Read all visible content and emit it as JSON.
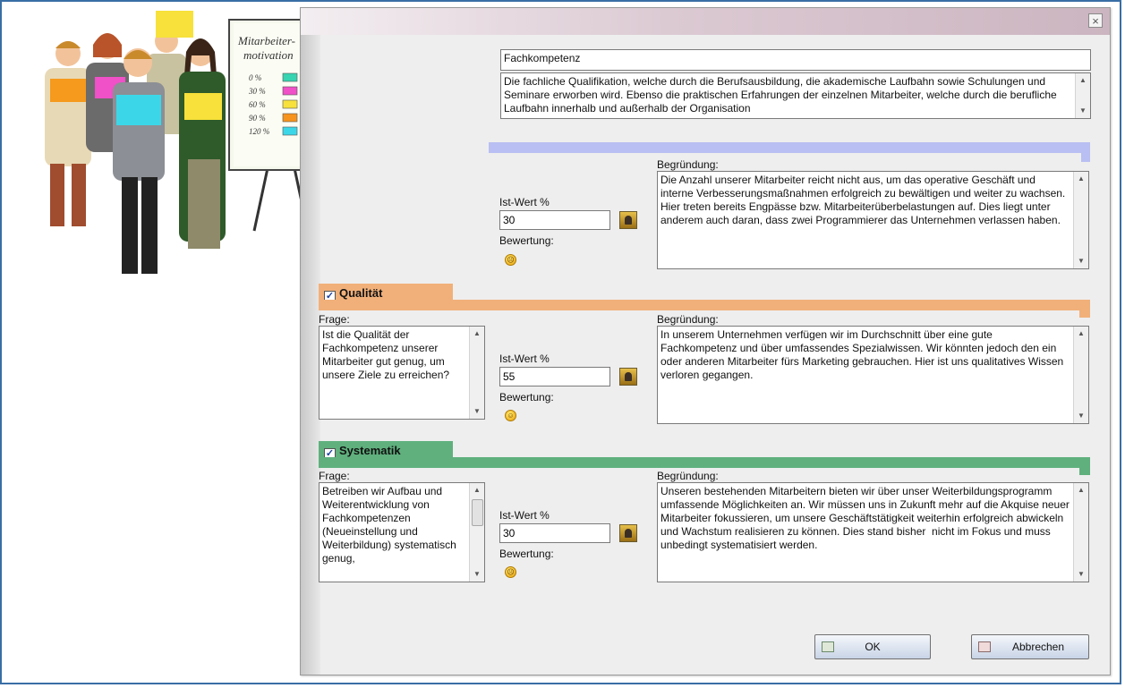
{
  "dialog": {
    "close_label": "×",
    "title_field": "Fachkompetenz",
    "description": "Die fachliche Qualifikation, welche durch die Berufsausbildung, die akademische Laufbahn sowie Schulungen und Seminare erworben wird. Ebenso die praktischen Erfahrungen der einzelnen Mitarbeiter, welche durch die berufliche Laufbahn innerhalb und außerhalb der Organisation",
    "colors": {
      "section1_band": "#b9bff2",
      "qualitaet_band": "#f1b07a",
      "systematik_band": "#5fb07d"
    }
  },
  "section1": {
    "ist_label": "Ist-Wert %",
    "ist_value": "30",
    "bewertung_label": "Bewertung:",
    "begruendung_label": "Begründung:",
    "begruendung": "Die Anzahl unserer Mitarbeiter reicht nicht aus, um das operative Geschäft und interne Verbesserungsmaßnahmen erfolgreich zu bewältigen und weiter zu wachsen. Hier treten bereits Engpässe bzw. Mitarbeiterüberbelastungen auf. Dies liegt unter anderem auch daran, dass zwei Programmierer das Unternehmen verlassen haben."
  },
  "qualitaet": {
    "tab_label": "Qualität",
    "frage_label": "Frage:",
    "frage": "Ist die Qualität der Fachkompetenz unserer Mitarbeiter gut genug, um unsere Ziele zu erreichen?",
    "ist_label": "Ist-Wert %",
    "ist_value": "55",
    "bewertung_label": "Bewertung:",
    "begruendung_label": "Begründung:",
    "begruendung": "In unserem Unternehmen verfügen wir im Durchschnitt über eine gute Fachkompetenz und über umfassendes Spezialwissen. Wir könnten jedoch den ein oder anderen Mitarbeiter fürs Marketing gebrauchen. Hier ist uns qualitatives Wissen verloren gegangen."
  },
  "systematik": {
    "tab_label": "Systematik",
    "frage_label": "Frage:",
    "frage": "Betreiben wir Aufbau und Weiterentwicklung von Fachkompetenzen (Neueinstellung und Weiterbildung) systematisch genug,",
    "ist_label": "Ist-Wert %",
    "ist_value": "30",
    "bewertung_label": "Bewertung:",
    "begruendung_label": "Begründung:",
    "begruendung": "Unseren bestehenden Mitarbeitern bieten wir über unser Weiterbildungsprogramm umfassende Möglichkeiten an. Wir müssen uns in Zukunft mehr auf die Akquise neuer Mitarbeiter fokussieren, um unsere Geschäftstätigkeit weiterhin erfolgreich abwickeln und Wachstum realisieren zu können. Dies stand bisher  nicht im Fokus und muss unbedingt systematisiert werden."
  },
  "buttons": {
    "ok": "OK",
    "cancel": "Abbrechen"
  },
  "illustration": {
    "board_title_1": "Mitarbeiter-",
    "board_title_2": "motivation",
    "board_rows": [
      "0 %",
      "30 %",
      "60 %",
      "90 %",
      "120 %"
    ],
    "board_colors": [
      "#36d4b0",
      "#f050c8",
      "#f7e13a",
      "#f7941d",
      "#3bd7e8"
    ]
  }
}
